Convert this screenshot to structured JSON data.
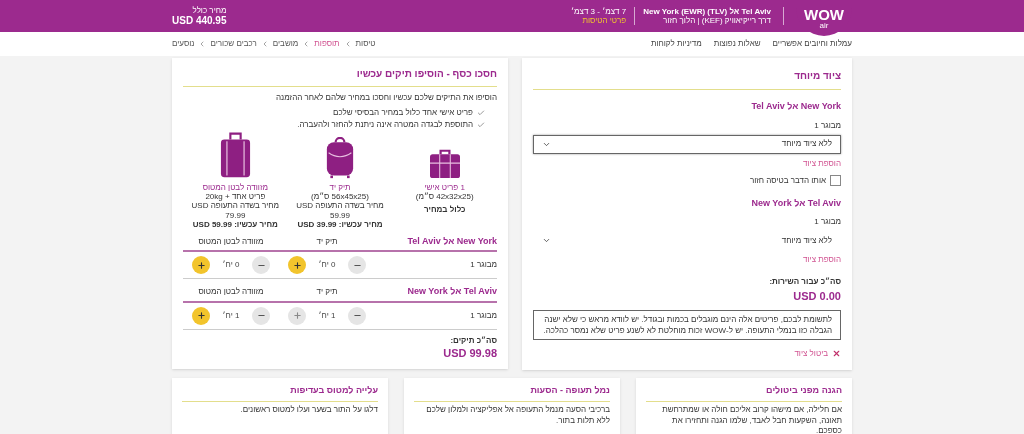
{
  "header": {
    "logo": "WOW",
    "logo_sub": "air",
    "route": "Tel Aviv אל (TLV) New York (EWR)",
    "route_sub": "דרך רייקיאוויק (KEF) | הלוך חזור",
    "dates": "7 דצמ׳ - 3 דצמ׳",
    "dates_link": "פרטי הטיסות",
    "price_label": "מחיר כולל",
    "price": "USD 440.95"
  },
  "top_links": [
    "עמלות וחיובים אפשריים",
    "שאלות נפוצות",
    "מדיניות לקוחות"
  ],
  "breadcrumb": [
    {
      "label": "טיסות",
      "selected": false
    },
    {
      "label": "תוספות",
      "selected": true
    },
    {
      "label": "מושבים",
      "selected": false
    },
    {
      "label": "רכבים שכורים",
      "selected": false
    },
    {
      "label": "נוסעים",
      "selected": false
    }
  ],
  "bags_card": {
    "title": "חסכו כסף - הוסיפו תיקים עכשיו",
    "intro": "הוסיפו את התיקים שלכם עכשיו וחסכו במחיר שלהם לאחר ההזמנה",
    "checks": [
      "פריט אישי אחד כלול במחיר הבסיסי שלכם",
      "התוספת לבגדה המטרה אינה ניתנת להחזר ולהעברה."
    ],
    "bags": [
      {
        "kind": "personal",
        "name": "1 פריט אישי",
        "size": "(42x32x25 ס״מ)",
        "price": "כלול במחיר"
      },
      {
        "kind": "cabin",
        "name": "תיק יד",
        "size": "(56x45x25 ס״מ)",
        "old_price": "מחיר בשדה התעופה USD 59.99",
        "price": "מחיר עכשיו: USD 39.99"
      },
      {
        "kind": "checked",
        "name": "מזוודה לבטן המטוס",
        "size": "פריט אחד + 20kg",
        "old_price": "מחיר בשדה התעופה USD 79.99",
        "price": "מחיר עכשיו: USD 59.99"
      }
    ],
    "legs": [
      {
        "route": "New York אל Tel Aviv",
        "columns": [
          "תיק יד",
          "מזוודה לבטן המטוס"
        ],
        "rows": [
          {
            "passenger": "מבוגר 1",
            "cells": [
              {
                "count": "0 יח׳",
                "plus_enabled": true
              },
              {
                "count": "0 יח׳",
                "plus_enabled": true
              }
            ]
          }
        ]
      },
      {
        "route": "Tel Aviv אל New York",
        "columns": [
          "תיק יד",
          "מזוודה לבטן המטוס"
        ],
        "rows": [
          {
            "passenger": "מבוגר 1",
            "cells": [
              {
                "count": "1 יח׳",
                "plus_enabled": false
              },
              {
                "count": "1 יח׳",
                "plus_enabled": true
              }
            ]
          }
        ]
      }
    ],
    "total_label": "סה״כ תיקים:",
    "total": "USD 99.98"
  },
  "equipment_card": {
    "title": "ציוד מיוחד",
    "legs": [
      {
        "route": "New York אל Tel Aviv",
        "passenger": "מבוגר 1",
        "select": "ללא ציוד מיוחד",
        "focused": true,
        "add": "הוספת ציוד",
        "same_return": {
          "label": "אותו הדבר בטיסה חזור",
          "checked": false
        }
      },
      {
        "route": "Tel Aviv אל New York",
        "passenger": "מבוגר 1",
        "select": "ללא ציוד מיוחד",
        "focused": false,
        "add": "הוספת ציוד"
      }
    ],
    "total_label": "סה״כ עבור השירות:",
    "total": "USD 0.00",
    "notice": "לתשומת לבכם, פריטים אלה הינם מוגבלים בכמות ובגודל. יש לוודא מראש כי שלא ישנה הגבלה כזו בנמלי התעופה. יש ל-WOW זכות מוחלטת לא לשנע פריט שלא נמסר כהלכה.",
    "cancel": "ביטול ציוד"
  },
  "promo_cards": [
    {
      "title": "הגנה מפני ביטולים",
      "text": "אם חלילה, אם מישהו קרוב אליכם חולה או שמתרחשת תאונה, השקעות חבל לאבד, שלמו הגנה ותחזירו את כספכם."
    },
    {
      "title": "נמל תעופה - הסעות",
      "text": "ברכיבי הסעה מנמל התעופה אל אפליקציה ולמלון שלכם ללא תלות בתור."
    },
    {
      "title": "עלייה למטוס בעדיפות",
      "text": "דלגו על התור בשער ועלו למטוס ראשונים."
    }
  ]
}
